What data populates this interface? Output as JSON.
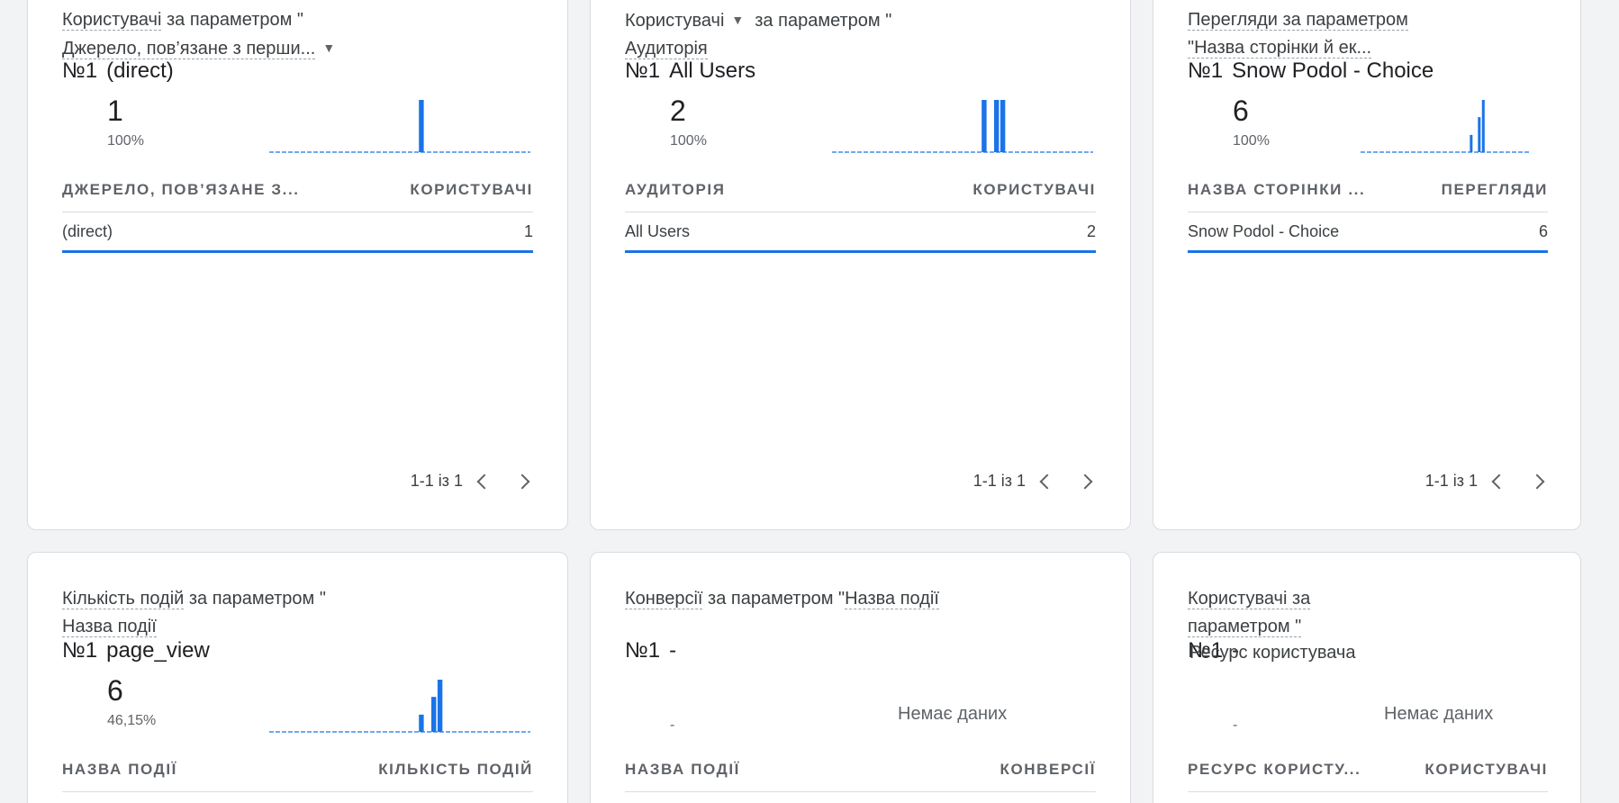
{
  "cards": [
    {
      "title_prefix": "Користувачі",
      "title_middle": " за параметром \"",
      "title_dim": "Джерело, пов’язане з перши...",
      "rank_num": "№1",
      "rank_label": "(direct)",
      "value": "1",
      "percent": "100%",
      "col_left": "ДЖЕРЕЛО, ПОВ’ЯЗАНЕ З...",
      "col_right": "КОРИСТУВАЧІ",
      "row_label": "(direct)",
      "row_value": "1",
      "pager": "1-1 із 1",
      "spark_bars": [
        0,
        0,
        0,
        0,
        0,
        0,
        0,
        0,
        0,
        0,
        0,
        0,
        0,
        0,
        0,
        0,
        0,
        0,
        0,
        0,
        0,
        0,
        0,
        0,
        1,
        0,
        0,
        0,
        0,
        0,
        0,
        0,
        0,
        0,
        0,
        0,
        0,
        0,
        0,
        0,
        0,
        0
      ]
    },
    {
      "title_prefix": "Користувачі",
      "title_middle": "за параметром \"",
      "title_dim": "Аудиторія",
      "rank_num": "№1",
      "rank_label": "All Users",
      "value": "2",
      "percent": "100%",
      "col_left": "АУДИТОРІЯ",
      "col_right": "КОРИСТУВАЧІ",
      "row_label": "All Users",
      "row_value": "2",
      "pager": "1-1 із 1",
      "spark_bars": [
        0,
        0,
        0,
        0,
        0,
        0,
        0,
        0,
        0,
        0,
        0,
        0,
        0,
        0,
        0,
        0,
        0,
        0,
        0,
        0,
        0,
        0,
        0,
        0,
        1,
        0,
        1,
        1,
        0,
        0,
        0,
        0,
        0,
        0,
        0,
        0,
        0,
        0,
        0,
        0,
        0,
        0
      ]
    },
    {
      "title_line1": "Перегляди за параметром",
      "title_line2": "\"Назва сторінки й ек...",
      "rank_num": "№1",
      "rank_label": "Snow Podol - Choice",
      "value": "6",
      "percent": "100%",
      "col_left": "НАЗВА СТОРІНКИ ...",
      "col_right": "ПЕРЕГЛЯДИ",
      "row_label": "Snow Podol - Choice",
      "row_value": "6",
      "pager": "1-1 із 1",
      "spark_bars": [
        0,
        0,
        0,
        0,
        0,
        0,
        0,
        0,
        0,
        0,
        0,
        0,
        0,
        0,
        0,
        0,
        0,
        0,
        0,
        0,
        0,
        0,
        0,
        0,
        0,
        0,
        0,
        0.33,
        0,
        0.67,
        1,
        0,
        0,
        0,
        0,
        0,
        0,
        0,
        0,
        0,
        0,
        0
      ]
    },
    {
      "title_prefix": "Кількість подій",
      "title_middle": " за параметром \"",
      "title_dim": "Назва події",
      "rank_num": "№1",
      "rank_label": "page_view",
      "value": "6",
      "percent": "46,15%",
      "col_left": "НАЗВА ПОДІЇ",
      "col_right": "КІЛЬКІСТЬ ПОДІЙ",
      "spark_bars": [
        0,
        0,
        0,
        0,
        0,
        0,
        0,
        0,
        0,
        0,
        0,
        0,
        0,
        0,
        0,
        0,
        0,
        0,
        0,
        0,
        0,
        0,
        0,
        0,
        0.33,
        0,
        0.67,
        1,
        0,
        0,
        0,
        0,
        0,
        0,
        0,
        0,
        0,
        0,
        0,
        0,
        0,
        0
      ]
    },
    {
      "title_prefix": "Конверсії",
      "title_middle": " за параметром \"",
      "title_dim": "Назва події",
      "rank_num": "№1",
      "rank_label": "-",
      "value": "-",
      "no_data": "Немає даних",
      "col_left": "НАЗВА ПОДІЇ",
      "col_right": "КОНВЕРСІЇ"
    },
    {
      "title_line1": "Користувачі за",
      "title_line2": "параметром \"",
      "rank_num": "№1",
      "rank_label": "-",
      "overlay_text": "Ресурс користувача",
      "value": "-",
      "no_data": "Немає даних",
      "col_left": "РЕСУРС КОРИСТУ...",
      "col_right": "КОРИСТУВАЧІ"
    }
  ],
  "colors": {
    "accent": "#1a73e8",
    "baseline": "#1a73e8"
  },
  "icons": [
    "caret-down-icon",
    "chevron-left-icon",
    "chevron-right-icon"
  ]
}
